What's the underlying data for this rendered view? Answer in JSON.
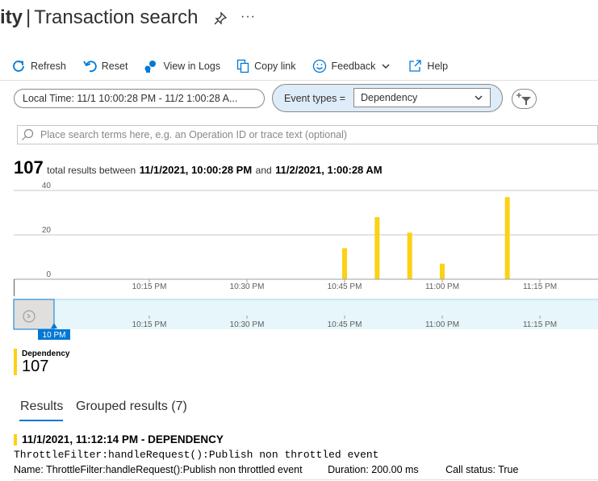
{
  "header": {
    "title_prefix": "ity",
    "separator": "|",
    "title": "Transaction search",
    "more": "···"
  },
  "toolbar": {
    "refresh": "Refresh",
    "reset": "Reset",
    "view_in_logs": "View in Logs",
    "copy_link": "Copy link",
    "feedback": "Feedback",
    "help": "Help"
  },
  "filters": {
    "time_range": "Local Time: 11/1 10:00:28 PM - 11/2 1:00:28 A...",
    "event_types_label": "Event types =",
    "event_types_value": "Dependency"
  },
  "search": {
    "placeholder": "Place search terms here, e.g. an Operation ID or trace text (optional)"
  },
  "totals": {
    "count": "107",
    "text1": "total results between",
    "start": "11/1/2021, 10:00:28 PM",
    "and": "and",
    "end": "11/2/2021, 1:00:28 AM"
  },
  "chart_data": {
    "type": "bar",
    "x": [
      "10:45 PM",
      "10:50 PM",
      "10:55 PM",
      "11:00 PM",
      "11:10 PM"
    ],
    "values": [
      14,
      28,
      21,
      7,
      37
    ],
    "ylim": [
      0,
      40
    ],
    "yticks": [
      "40",
      "20",
      "0"
    ],
    "xticks": [
      "10:15 PM",
      "10:30 PM",
      "10:45 PM",
      "11:00 PM",
      "11:15 PM"
    ],
    "brush_label": "10 PM",
    "color": "#fcd116",
    "grid": true
  },
  "legend": {
    "name": "Dependency",
    "value": "107"
  },
  "tabs": {
    "results": "Results",
    "grouped": "Grouped results (7)"
  },
  "result": {
    "title": "11/1/2021, 11:12:14 PM - DEPENDENCY",
    "message": "ThrottleFilter:handleRequest():Publish non throttled event",
    "name": "Name: ThrottleFilter:handleRequest():Publish non throttled event",
    "duration": "Duration: 200.00 ms",
    "status": "Call status: True"
  }
}
